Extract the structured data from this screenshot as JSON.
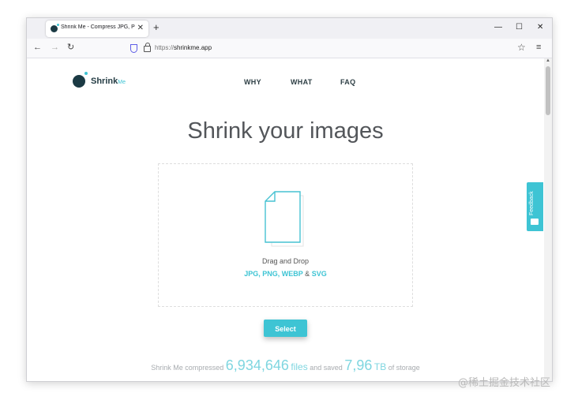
{
  "browser": {
    "tab_title": "Shrink Me - Compress JPG, PNG",
    "tab_close": "✕",
    "new_tab": "+",
    "url_protocol": "https://",
    "url_host": "shrinkme.app",
    "window_controls": {
      "minimize": "—",
      "maximize": "☐",
      "close": "✕"
    },
    "nav": {
      "back": "←",
      "forward": "→",
      "reload": "↻"
    },
    "icons": {
      "shield": "shield-icon",
      "lock": "lock-icon",
      "star": "☆",
      "menu": "≡"
    }
  },
  "site": {
    "logo_text": "Shrink",
    "logo_suffix": "Me",
    "menu": [
      "WHY",
      "WHAT",
      "FAQ"
    ]
  },
  "hero": {
    "title": "Shrink your images",
    "drag_text": "Drag and Drop",
    "formats": "JPG, PNG, WEBP",
    "formats_amp": "&",
    "formats_last": "SVG",
    "select_button": "Select"
  },
  "stats": {
    "prefix": "Shrink Me compressed",
    "files_count": "6,934,646",
    "files_label": "files",
    "middle": "and saved",
    "saved_amount": "7,96",
    "saved_unit": "TB",
    "suffix": "of storage"
  },
  "feedback": {
    "label": "Feedback"
  },
  "watermark": "@稀土掘金技术社区",
  "colors": {
    "accent": "#3ec4d4",
    "logo_dark": "#1b3a44"
  }
}
